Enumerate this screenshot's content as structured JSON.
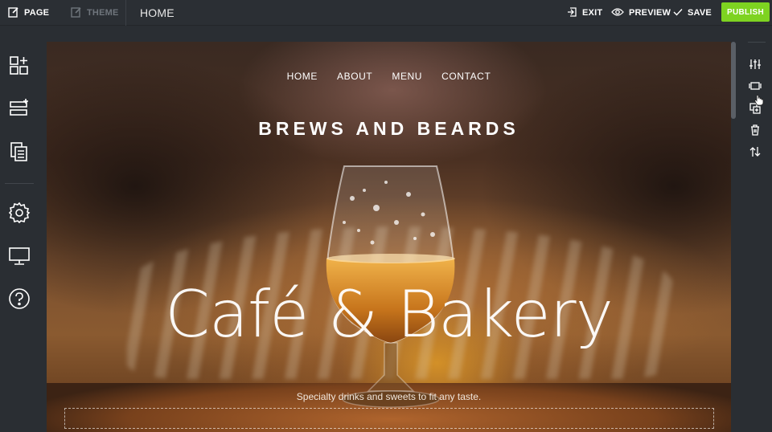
{
  "topbar": {
    "page_label": "PAGE",
    "theme_label": "THEME",
    "current_page": "HOME",
    "exit_label": "EXIT",
    "preview_label": "PREVIEW",
    "save_label": "SAVE",
    "publish_label": "PUBLISH"
  },
  "sidebar": {
    "items": [
      {
        "icon": "add-section-icon"
      },
      {
        "icon": "add-row-icon"
      },
      {
        "icon": "pages-icon"
      },
      {
        "icon": "settings-icon"
      },
      {
        "icon": "desktop-preview-icon"
      },
      {
        "icon": "help-icon"
      }
    ]
  },
  "rightbar": {
    "items": [
      {
        "icon": "adjust-sliders-icon"
      },
      {
        "icon": "section-layout-icon"
      },
      {
        "icon": "duplicate-icon"
      },
      {
        "icon": "delete-icon"
      },
      {
        "icon": "reorder-icon"
      }
    ]
  },
  "site": {
    "nav": [
      "HOME",
      "ABOUT",
      "MENU",
      "CONTACT"
    ],
    "title": "BREWS AND BEARDS",
    "hero_title": "Café & Bakery",
    "hero_subtitle": "Specialty drinks and sweets to fit any taste."
  },
  "colors": {
    "publish": "#7ed321",
    "chrome": "#2b2f34"
  }
}
